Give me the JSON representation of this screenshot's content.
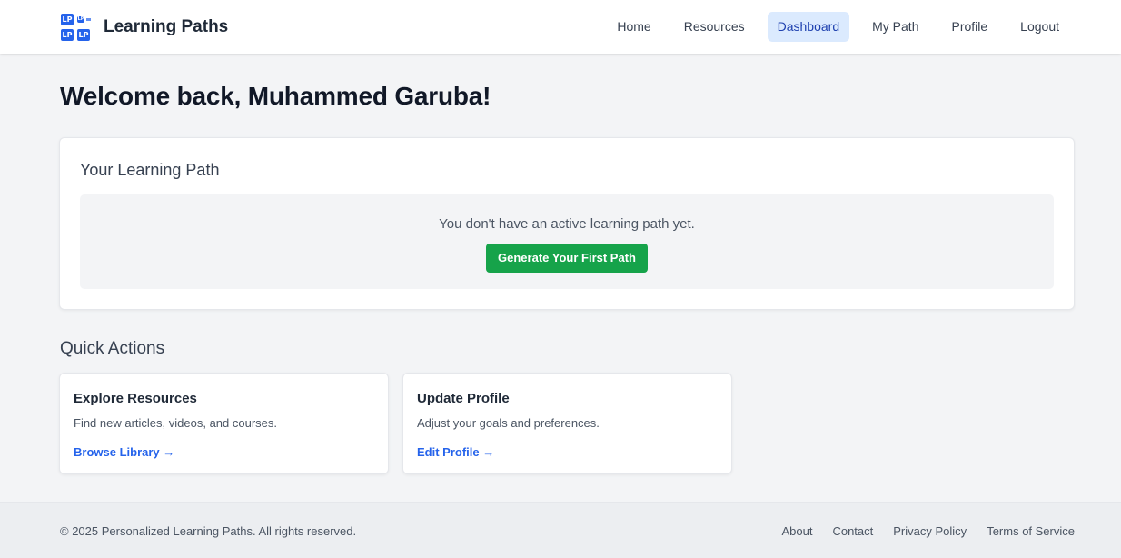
{
  "header": {
    "brand": "Learning Paths",
    "logo_icon": "lp-logo-icon",
    "logo_tiles": [
      "LP",
      "LP",
      "LP",
      "LP"
    ],
    "nav": [
      {
        "label": "Home",
        "active": false
      },
      {
        "label": "Resources",
        "active": false
      },
      {
        "label": "Dashboard",
        "active": true
      },
      {
        "label": "My Path",
        "active": false
      },
      {
        "label": "Profile",
        "active": false
      },
      {
        "label": "Logout",
        "active": false
      }
    ]
  },
  "main": {
    "welcome": "Welcome back, Muhammed Garuba!",
    "path_card": {
      "title": "Your Learning Path",
      "empty_message": "You don't have an active learning path yet.",
      "button_label": "Generate Your First Path"
    },
    "quick_actions": {
      "title": "Quick Actions",
      "cards": [
        {
          "title": "Explore Resources",
          "description": "Find new articles, videos, and courses.",
          "link": "Browse Library →"
        },
        {
          "title": "Update Profile",
          "description": "Adjust your goals and preferences.",
          "link": "Edit Profile →"
        }
      ]
    }
  },
  "footer": {
    "copyright": "© 2025 Personalized Learning Paths. All rights reserved.",
    "links": [
      "About",
      "Contact",
      "Privacy Policy",
      "Terms of Service"
    ]
  },
  "colors": {
    "primary": "#2563eb",
    "active_nav_bg": "#dbeafe",
    "button_green": "#16a34a",
    "page_bg": "#f3f4f6"
  }
}
